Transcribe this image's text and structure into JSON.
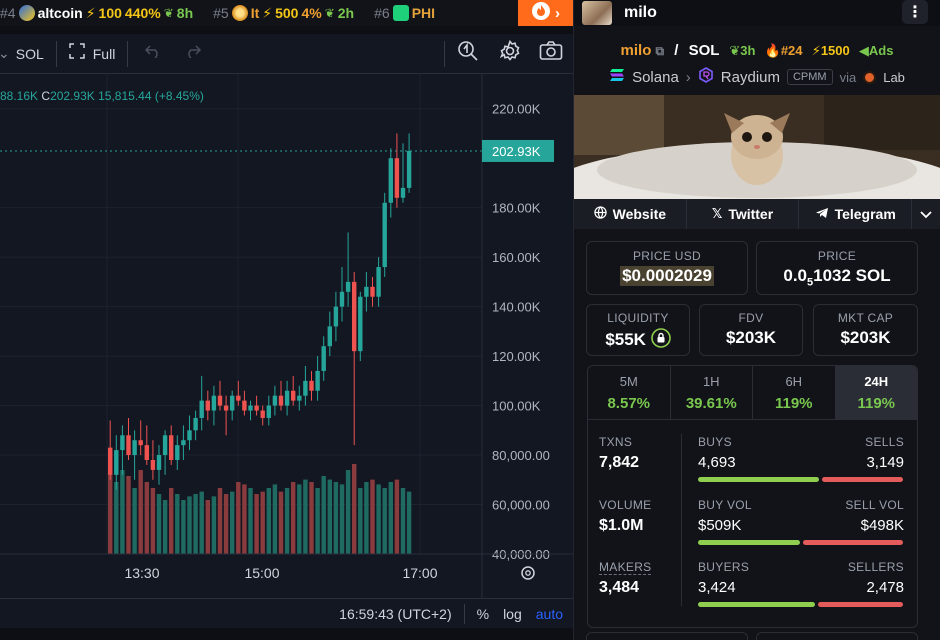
{
  "ticker": [
    {
      "rank": "#4",
      "name": "altcoin",
      "boost": "100",
      "pct": "440%",
      "age": "8h"
    },
    {
      "rank": "#5",
      "name": "It",
      "boost": "500",
      "pct": "4%",
      "age": "2h"
    },
    {
      "rank": "#6",
      "name": "PHI"
    }
  ],
  "toolbar": {
    "currency": "SOL",
    "full_label": "Full"
  },
  "ohlc": {
    "partial": "88.16K",
    "close_label": "C",
    "close": "202.93K",
    "change": "15,815.44 (+8.45%)"
  },
  "price_axis": {
    "labels": [
      "220.00K",
      "202.93K",
      "180.00K",
      "160.00K",
      "140.00K",
      "120.00K",
      "100.00K",
      "80,000.00",
      "60,000.00",
      "40,000.00"
    ],
    "current": "202.93K"
  },
  "time_axis": [
    "13:30",
    "15:00",
    "17:00"
  ],
  "bottom_bar": {
    "time": "16:59:43 (UTC+2)",
    "percent": "%",
    "log": "log",
    "auto": "auto"
  },
  "colors": {
    "up": "#26a69a",
    "down": "#ef5350",
    "accent": "#ff6b1a",
    "green": "#7ac74f",
    "orange": "#f0a030"
  },
  "chart_data": {
    "type": "candlestick",
    "y_range": [
      40000,
      230000
    ],
    "candles": [
      {
        "o": 83000,
        "h": 94000,
        "l": 70000,
        "c": 72000
      },
      {
        "o": 72000,
        "h": 88000,
        "l": 66000,
        "c": 82000
      },
      {
        "o": 82000,
        "h": 92000,
        "l": 72000,
        "c": 88000
      },
      {
        "o": 88000,
        "h": 95000,
        "l": 78000,
        "c": 80000
      },
      {
        "o": 80000,
        "h": 90000,
        "l": 70000,
        "c": 86000
      },
      {
        "o": 86000,
        "h": 94000,
        "l": 80000,
        "c": 84000
      },
      {
        "o": 84000,
        "h": 92000,
        "l": 76000,
        "c": 78000
      },
      {
        "o": 78000,
        "h": 86000,
        "l": 70000,
        "c": 74000
      },
      {
        "o": 74000,
        "h": 84000,
        "l": 68000,
        "c": 80000
      },
      {
        "o": 80000,
        "h": 90000,
        "l": 72000,
        "c": 88000
      },
      {
        "o": 88000,
        "h": 92000,
        "l": 76000,
        "c": 78000
      },
      {
        "o": 78000,
        "h": 88000,
        "l": 74000,
        "c": 84000
      },
      {
        "o": 84000,
        "h": 92000,
        "l": 78000,
        "c": 86000
      },
      {
        "o": 86000,
        "h": 96000,
        "l": 82000,
        "c": 90000
      },
      {
        "o": 90000,
        "h": 98000,
        "l": 86000,
        "c": 95000
      },
      {
        "o": 95000,
        "h": 112000,
        "l": 90000,
        "c": 102000
      },
      {
        "o": 102000,
        "h": 106000,
        "l": 94000,
        "c": 98000
      },
      {
        "o": 98000,
        "h": 108000,
        "l": 92000,
        "c": 104000
      },
      {
        "o": 104000,
        "h": 110000,
        "l": 98000,
        "c": 100000
      },
      {
        "o": 100000,
        "h": 104000,
        "l": 88000,
        "c": 98000
      },
      {
        "o": 98000,
        "h": 106000,
        "l": 94000,
        "c": 104000
      },
      {
        "o": 104000,
        "h": 110000,
        "l": 100000,
        "c": 102000
      },
      {
        "o": 102000,
        "h": 106000,
        "l": 96000,
        "c": 98000
      },
      {
        "o": 98000,
        "h": 102000,
        "l": 94000,
        "c": 100000
      },
      {
        "o": 100000,
        "h": 104000,
        "l": 96000,
        "c": 98000
      },
      {
        "o": 98000,
        "h": 100000,
        "l": 92000,
        "c": 95000
      },
      {
        "o": 95000,
        "h": 104000,
        "l": 92000,
        "c": 100000
      },
      {
        "o": 100000,
        "h": 108000,
        "l": 96000,
        "c": 104000
      },
      {
        "o": 104000,
        "h": 110000,
        "l": 98000,
        "c": 100000
      },
      {
        "o": 100000,
        "h": 110000,
        "l": 96000,
        "c": 106000
      },
      {
        "o": 106000,
        "h": 112000,
        "l": 100000,
        "c": 102000
      },
      {
        "o": 102000,
        "h": 108000,
        "l": 98000,
        "c": 104000
      },
      {
        "o": 104000,
        "h": 116000,
        "l": 100000,
        "c": 110000
      },
      {
        "o": 110000,
        "h": 114000,
        "l": 102000,
        "c": 106000
      },
      {
        "o": 106000,
        "h": 120000,
        "l": 102000,
        "c": 114000
      },
      {
        "o": 114000,
        "h": 128000,
        "l": 110000,
        "c": 124000
      },
      {
        "o": 124000,
        "h": 138000,
        "l": 120000,
        "c": 132000
      },
      {
        "o": 132000,
        "h": 146000,
        "l": 126000,
        "c": 140000
      },
      {
        "o": 140000,
        "h": 156000,
        "l": 134000,
        "c": 146000
      },
      {
        "o": 146000,
        "h": 170000,
        "l": 140000,
        "c": 150000
      },
      {
        "o": 150000,
        "h": 154000,
        "l": 84000,
        "c": 122000
      },
      {
        "o": 122000,
        "h": 146000,
        "l": 118000,
        "c": 144000
      },
      {
        "o": 144000,
        "h": 154000,
        "l": 138000,
        "c": 148000
      },
      {
        "o": 148000,
        "h": 152000,
        "l": 140000,
        "c": 144000
      },
      {
        "o": 144000,
        "h": 160000,
        "l": 140000,
        "c": 156000
      },
      {
        "o": 156000,
        "h": 186000,
        "l": 152000,
        "c": 182000
      },
      {
        "o": 182000,
        "h": 204000,
        "l": 176000,
        "c": 200000
      },
      {
        "o": 200000,
        "h": 210000,
        "l": 180000,
        "c": 184000
      },
      {
        "o": 184000,
        "h": 206000,
        "l": 182000,
        "c": 188000
      },
      {
        "o": 188000,
        "h": 210000,
        "l": 186000,
        "c": 202930
      }
    ],
    "volume_rel": [
      0.85,
      0.6,
      0.7,
      0.65,
      0.55,
      0.7,
      0.6,
      0.55,
      0.5,
      0.45,
      0.55,
      0.5,
      0.45,
      0.48,
      0.5,
      0.52,
      0.45,
      0.48,
      0.55,
      0.5,
      0.52,
      0.6,
      0.58,
      0.55,
      0.5,
      0.52,
      0.55,
      0.58,
      0.52,
      0.55,
      0.6,
      0.58,
      0.62,
      0.6,
      0.55,
      0.65,
      0.62,
      0.6,
      0.58,
      0.7,
      0.75,
      0.55,
      0.6,
      0.62,
      0.58,
      0.55,
      0.6,
      0.62,
      0.55,
      0.52
    ]
  },
  "panel": {
    "header_name": "milo",
    "token_symbol": "milo",
    "quote": "SOL",
    "age": "3h",
    "rank": "#24",
    "boost": "1500",
    "ads": "Ads",
    "chain": "Solana",
    "dex": "Raydium",
    "pool_type": "CPMM",
    "via": "via",
    "launchpad": "Lab",
    "links": {
      "website": "Website",
      "twitter": "Twitter",
      "telegram": "Telegram"
    },
    "price_usd_label": "PRICE USD",
    "price_usd": "$0.0002029",
    "price_label": "PRICE",
    "price_native_a": "0.0",
    "price_native_sub": "5",
    "price_native_b": "1032 SOL",
    "liquidity_label": "LIQUIDITY",
    "liquidity": "$55K",
    "fdv_label": "FDV",
    "fdv": "$203K",
    "mcap_label": "MKT CAP",
    "mcap": "$203K",
    "timeframes": [
      {
        "label": "5M",
        "pct": "8.57%"
      },
      {
        "label": "1H",
        "pct": "39.61%"
      },
      {
        "label": "6H",
        "pct": "119%"
      },
      {
        "label": "24H",
        "pct": "119%"
      }
    ],
    "txns_label": "TXNS",
    "txns": "7,842",
    "buys_label": "BUYS",
    "buys": "4,693",
    "sells_label": "SELLS",
    "sells": "3,149",
    "buys_ratio": 0.6,
    "volume_label": "VOLUME",
    "volume": "$1.0M",
    "buy_vol_label": "BUY VOL",
    "buy_vol": "$509K",
    "sell_vol_label": "SELL VOL",
    "sell_vol": "$498K",
    "buy_vol_ratio": 0.505,
    "makers_label": "MAKERS",
    "makers": "3,484",
    "buyers_label": "BUYERS",
    "buyers": "3,424",
    "sellers_label": "SELLERS",
    "sellers": "2,478",
    "buyers_ratio": 0.58
  }
}
